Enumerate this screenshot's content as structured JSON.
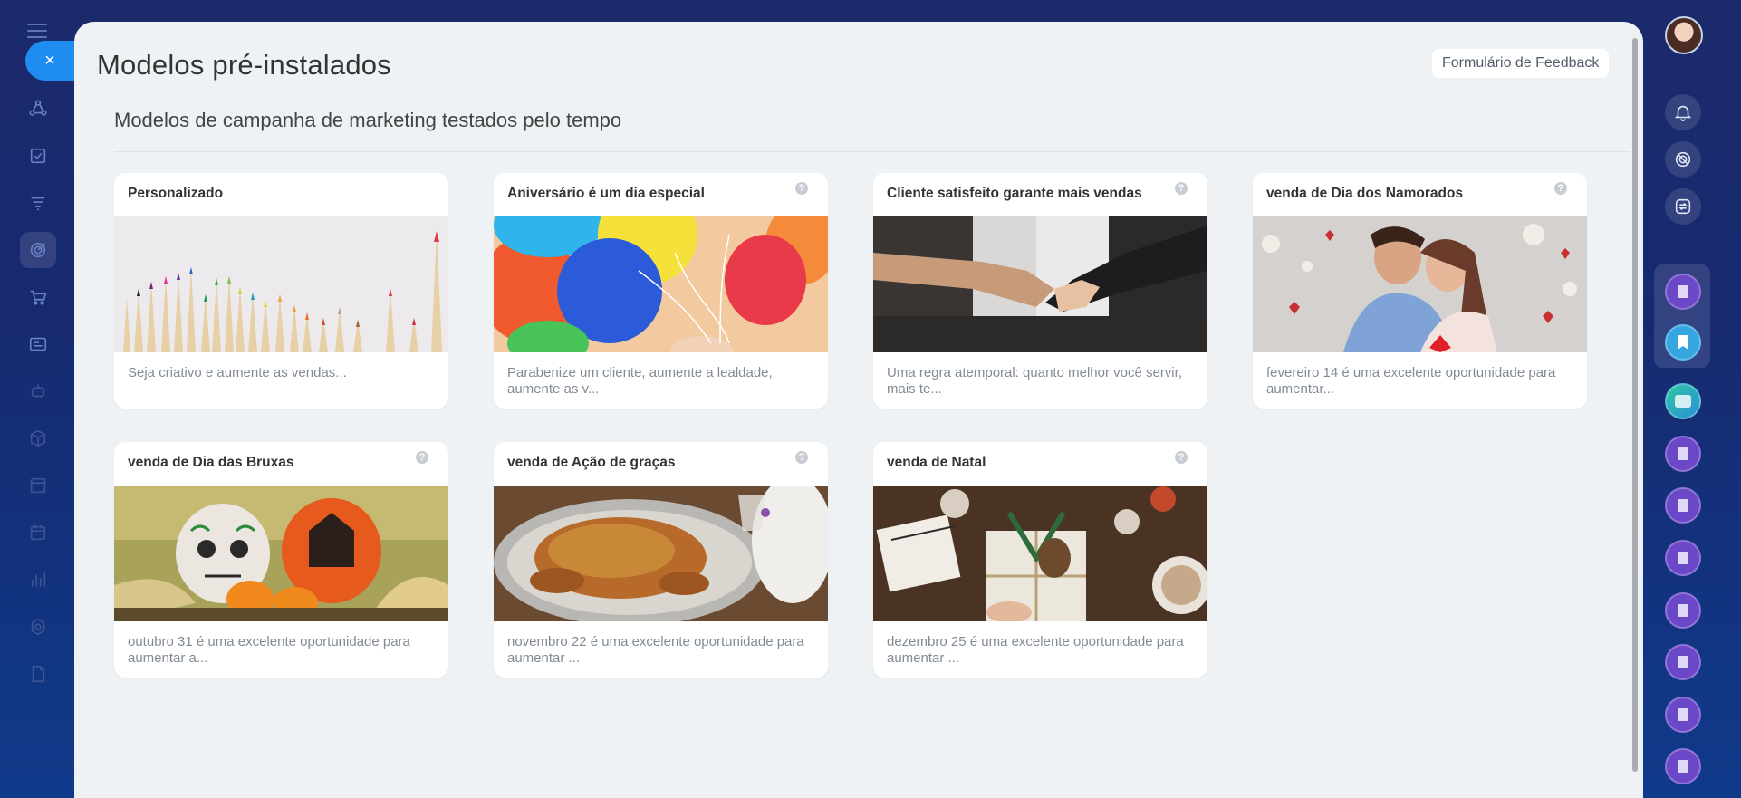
{
  "header": {
    "title": "Modelos pré-instalados",
    "feedback_button": "Formulário de Feedback",
    "subtitle": "Modelos de campanha de marketing testados pelo tempo",
    "close_label": "×"
  },
  "cards": [
    {
      "title": "Personalizado",
      "desc": "Seja criativo e aumente as vendas...",
      "image": "colored-pencils"
    },
    {
      "title": "Aniversário é um dia especial",
      "desc": "Parabenize um cliente, aumente a lealdade, aumente as v...",
      "image": "balloons"
    },
    {
      "title": "Cliente satisfeito garante mais vendas",
      "desc": "Uma regra atemporal: quanto melhor você servir, mais te...",
      "image": "handshake"
    },
    {
      "title": "venda de Dia dos Namorados",
      "desc": "fevereiro 14 é uma excelente oportunidade para aumentar...",
      "image": "couple-hearts"
    },
    {
      "title": "venda de Dia das Bruxas",
      "desc": "outubro 31 é uma excelente oportunidade para aumentar a...",
      "image": "pumpkins"
    },
    {
      "title": "venda de Ação de graças",
      "desc": "novembro 22 é uma excelente oportunidade para aumentar ...",
      "image": "roast-turkey"
    },
    {
      "title": "venda de Natal",
      "desc": "dezembro 25 é uma excelente oportunidade para aumentar ...",
      "image": "christmas-gift"
    }
  ],
  "help_glyph": "?",
  "colors": {
    "accent": "#1f8cf0",
    "panel_bg": "#eef2f4",
    "nav_bg": "#1b2a6b"
  }
}
